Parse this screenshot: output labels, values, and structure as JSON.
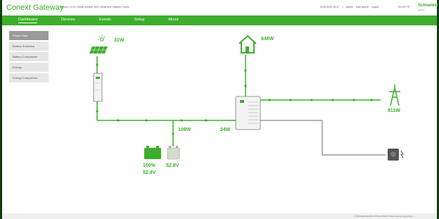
{
  "header": {
    "app_title": "Conext Gateway",
    "sub_info": "Version: v1.01 | Serial number: 503 | Serial and Children Found",
    "timestamp": "02/01/2020 16:37",
    "user": "Admin",
    "role": "User admin",
    "logout": "Logout",
    "lang": "EN  ES  FR",
    "logo": "Schneider",
    "logo_sub": "Electric"
  },
  "nav": {
    "items": [
      "Dashboard",
      "Devices",
      "Events",
      "Setup",
      "About"
    ],
    "active": "Dashboard"
  },
  "sidebar": {
    "items": [
      {
        "label": "Power Flow",
        "active": true
      },
      {
        "label": "Battery Summary",
        "active": false
      },
      {
        "label": "Battery Comparison",
        "active": false
      },
      {
        "label": "Energy",
        "active": false
      },
      {
        "label": "Energy Comparison",
        "active": false
      }
    ]
  },
  "powerflow": {
    "pv_power": "31W",
    "load_power": "646W",
    "grid_power": "911W",
    "battery_power": "109W",
    "inverter_power": "24W",
    "battery_soc": "100%",
    "battery_voltage": "52.4V",
    "battery2_voltage": "52.8V"
  },
  "colors": {
    "brand": "#3dae2b",
    "line": "#3dae2b",
    "inactive_line": "#9a9a9a"
  },
  "footer": {
    "text": "© Schneider Electric  |  Privacy Policy  |  User License Agreement"
  }
}
